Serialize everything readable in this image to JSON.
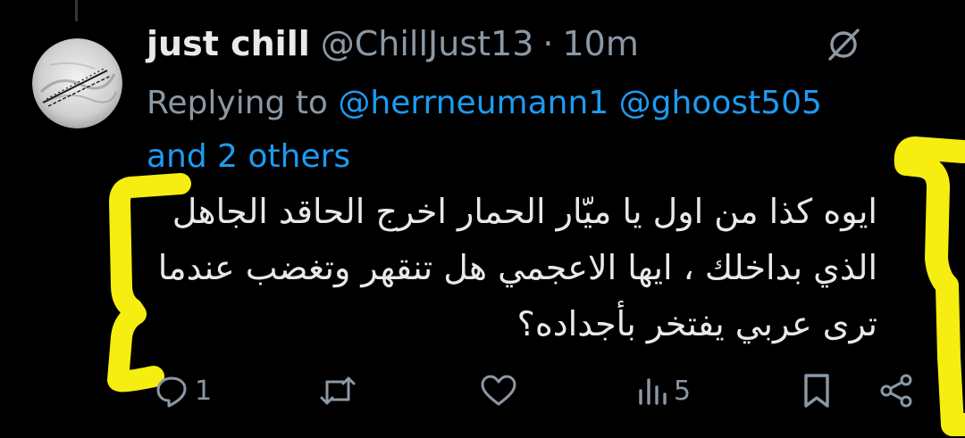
{
  "tweet": {
    "display_name": "just chill",
    "handle": "@ChillJust13",
    "separator": "·",
    "time": "10m",
    "replying": {
      "prefix": "Replying to",
      "mentions": [
        "@herrneumann1",
        "@ghoost505"
      ],
      "others": "and 2 others"
    },
    "text_lines": [
      "ايوه كذا من اول يا ميّار الحمار اخرج الحاقد الجاهل",
      "الذي بداخلك ، ايها الاعجمي هل تنقهر وتغضب عندما",
      "ترى عربي يفتخر بأجداده؟"
    ]
  },
  "actions": {
    "reply": {
      "icon": "reply-icon",
      "count": "1"
    },
    "retweet": {
      "icon": "retweet-icon",
      "count": ""
    },
    "like": {
      "icon": "heart-icon",
      "count": ""
    },
    "views": {
      "icon": "views-icon",
      "count": "5"
    },
    "bookmark": {
      "icon": "bookmark-icon"
    },
    "share": {
      "icon": "share-icon"
    }
  },
  "colors": {
    "background": "#000000",
    "text": "#e7e9ea",
    "muted": "#8b98a5",
    "link": "#1d9bf0",
    "highlight_marker": "#f5ee10"
  }
}
